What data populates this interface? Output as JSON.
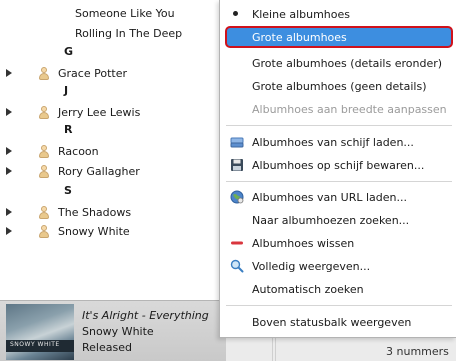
{
  "library": {
    "rows": [
      {
        "type": "song",
        "label": "Someone Like You"
      },
      {
        "type": "song",
        "label": "Rolling In The Deep"
      },
      {
        "type": "letter",
        "label": "G"
      },
      {
        "type": "artist",
        "label": "Grace Potter"
      },
      {
        "type": "letter",
        "label": "J"
      },
      {
        "type": "artist",
        "label": "Jerry Lee Lewis"
      },
      {
        "type": "letter",
        "label": "R"
      },
      {
        "type": "artist",
        "label": "Racoon"
      },
      {
        "type": "artist",
        "label": "Rory Gallagher"
      },
      {
        "type": "letter",
        "label": "S"
      },
      {
        "type": "artist",
        "label": "The Shadows"
      },
      {
        "type": "artist",
        "label": "Snowy White"
      }
    ]
  },
  "now_playing": {
    "title": "It's Alright - Everything",
    "artist": "Snowy White",
    "album": "Released",
    "cover_text": "SNOWY WHITE"
  },
  "status": {
    "count": "3 nummers"
  },
  "menu": {
    "items": [
      {
        "label": "Kleine albumhoes",
        "icon": "radio-bullet-icon",
        "state": "checked"
      },
      {
        "label": "Grote albumhoes",
        "icon": "",
        "state": "selected"
      },
      {
        "label": "Grote albumhoes (details eronder)",
        "icon": "",
        "state": "normal"
      },
      {
        "label": "Grote albumhoes (geen details)",
        "icon": "",
        "state": "normal"
      },
      {
        "label": "Albumhoes aan breedte aanpassen",
        "icon": "",
        "state": "disabled"
      },
      {
        "label": "Albumhoes van schijf laden...",
        "icon": "hard-drive-icon",
        "state": "normal"
      },
      {
        "label": "Albumhoes op schijf bewaren...",
        "icon": "floppy-disk-icon",
        "state": "normal"
      },
      {
        "label": "Albumhoes van URL laden...",
        "icon": "globe-icon",
        "state": "normal"
      },
      {
        "label": "Naar albumhoezen zoeken...",
        "icon": "",
        "state": "normal"
      },
      {
        "label": "Albumhoes wissen",
        "icon": "remove-icon",
        "state": "normal"
      },
      {
        "label": "Volledig weergeven...",
        "icon": "zoom-icon",
        "state": "normal"
      },
      {
        "label": "Automatisch zoeken",
        "icon": "",
        "state": "normal"
      },
      {
        "label": "Boven statusbalk weergeven",
        "icon": "",
        "state": "normal"
      }
    ]
  },
  "colors": {
    "selection": "#3d8ee0",
    "selection_outline": "#d0121b",
    "remove_icon": "#d9363e"
  }
}
